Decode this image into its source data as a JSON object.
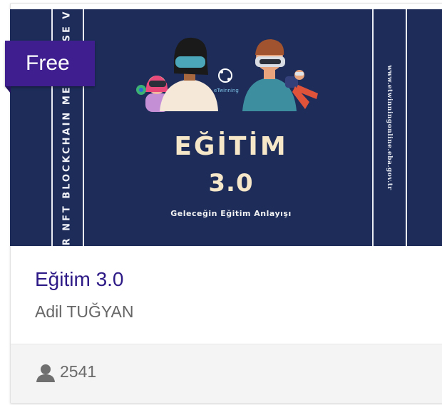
{
  "badge": {
    "label": "Free"
  },
  "cover": {
    "side_keywords": "AR   NFT   BLOCKCHAIN   METAVERSE   VR",
    "headline_line1": "EĞİTİM",
    "headline_line2": "3.0",
    "subtitle": "Geleceğin Eğitim Anlayışı",
    "url": "www.etwinningonline.eba.gov.tr",
    "logo_text": "eTwinning"
  },
  "course": {
    "title": "Eğitim 3.0",
    "author": "Adil TUĞYAN"
  },
  "footer": {
    "enrollment_count": "2541",
    "icon": "user-icon"
  },
  "colors": {
    "cover_bg": "#1d2c59",
    "badge_bg": "#3f1f8f",
    "title": "#2e1a86",
    "headline": "#f6e7c9"
  }
}
